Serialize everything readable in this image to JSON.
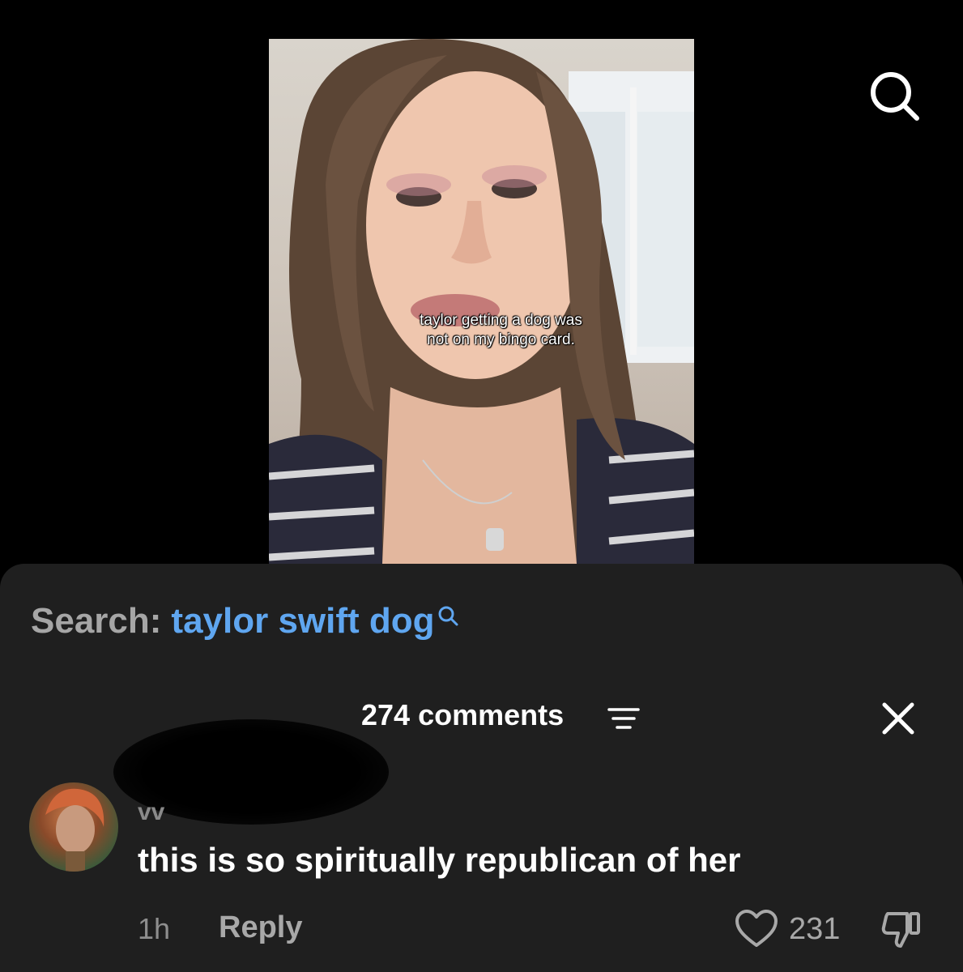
{
  "video": {
    "caption_lines": [
      "taylor getting a dog was",
      "not on my bingo card."
    ]
  },
  "search": {
    "prefix": "Search:",
    "term": "taylor swift dog"
  },
  "comments": {
    "count_label": "274 comments"
  },
  "comment": {
    "username_fragment": "vᴠ",
    "text": "this is so spiritually republican of her",
    "time": "1h",
    "reply_label": "Reply",
    "like_count": "231"
  },
  "icons": {
    "top_search": "search-icon",
    "inline_search": "search-icon",
    "sort": "sort-icon",
    "close": "close-icon",
    "like": "heart-icon",
    "dislike": "thumbs-down-icon"
  },
  "colors": {
    "accent": "#5fa6f0",
    "sheet": "#1f1f1f",
    "muted": "#a8a8a8"
  }
}
